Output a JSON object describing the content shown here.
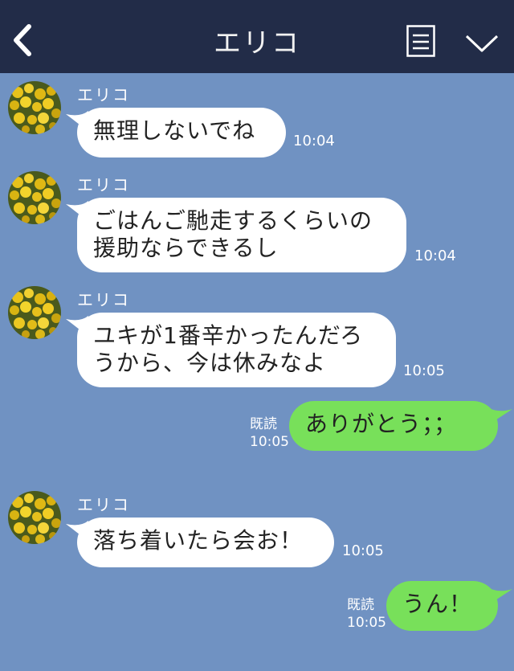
{
  "header": {
    "title": "エリコ"
  },
  "messages": [
    {
      "sender": "エリコ",
      "text": [
        "無理しないでね"
      ],
      "time": "10:04"
    },
    {
      "sender": "エリコ",
      "text": [
        "ごはんご馳走するくらいの",
        "援助ならできるし"
      ],
      "time": "10:04"
    },
    {
      "sender": "エリコ",
      "text": [
        "ユキが1番辛かったんだろ",
        "うから、今は休みなよ"
      ],
      "time": "10:05"
    },
    {
      "text": [
        "ありがとう；；"
      ],
      "read": "既読",
      "time": "10:05"
    },
    {
      "sender": "エリコ",
      "text": [
        "落ち着いたら会お！"
      ],
      "time": "10:05"
    },
    {
      "text": [
        "うん！"
      ],
      "read": "既読",
      "time": "10:05"
    }
  ],
  "colors": {
    "header_bg": "#222c48",
    "chat_bg": "#7092c2",
    "incoming_bubble": "#ffffff",
    "outgoing_bubble": "#78e05a"
  }
}
